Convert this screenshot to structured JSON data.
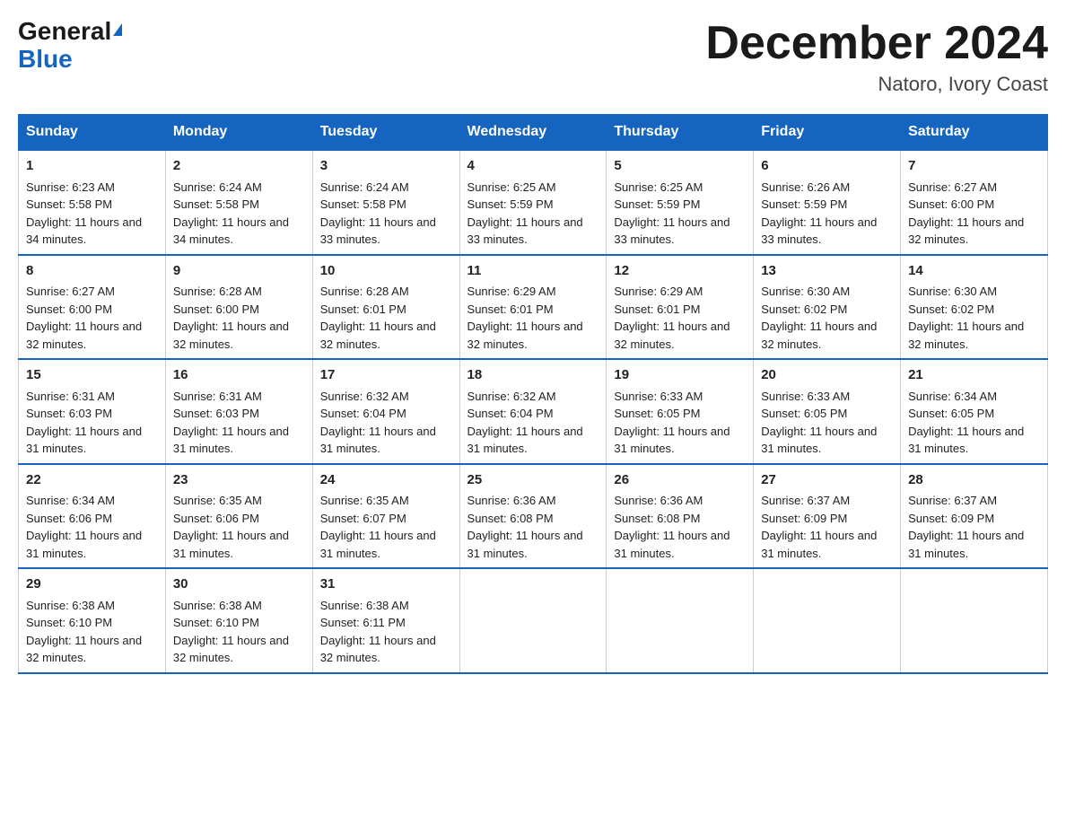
{
  "header": {
    "logo_general": "General",
    "logo_blue": "Blue",
    "month_title": "December 2024",
    "location": "Natoro, Ivory Coast"
  },
  "days_of_week": [
    "Sunday",
    "Monday",
    "Tuesday",
    "Wednesday",
    "Thursday",
    "Friday",
    "Saturday"
  ],
  "weeks": [
    [
      {
        "day": "1",
        "sunrise": "Sunrise: 6:23 AM",
        "sunset": "Sunset: 5:58 PM",
        "daylight": "Daylight: 11 hours and 34 minutes."
      },
      {
        "day": "2",
        "sunrise": "Sunrise: 6:24 AM",
        "sunset": "Sunset: 5:58 PM",
        "daylight": "Daylight: 11 hours and 34 minutes."
      },
      {
        "day": "3",
        "sunrise": "Sunrise: 6:24 AM",
        "sunset": "Sunset: 5:58 PM",
        "daylight": "Daylight: 11 hours and 33 minutes."
      },
      {
        "day": "4",
        "sunrise": "Sunrise: 6:25 AM",
        "sunset": "Sunset: 5:59 PM",
        "daylight": "Daylight: 11 hours and 33 minutes."
      },
      {
        "day": "5",
        "sunrise": "Sunrise: 6:25 AM",
        "sunset": "Sunset: 5:59 PM",
        "daylight": "Daylight: 11 hours and 33 minutes."
      },
      {
        "day": "6",
        "sunrise": "Sunrise: 6:26 AM",
        "sunset": "Sunset: 5:59 PM",
        "daylight": "Daylight: 11 hours and 33 minutes."
      },
      {
        "day": "7",
        "sunrise": "Sunrise: 6:27 AM",
        "sunset": "Sunset: 6:00 PM",
        "daylight": "Daylight: 11 hours and 32 minutes."
      }
    ],
    [
      {
        "day": "8",
        "sunrise": "Sunrise: 6:27 AM",
        "sunset": "Sunset: 6:00 PM",
        "daylight": "Daylight: 11 hours and 32 minutes."
      },
      {
        "day": "9",
        "sunrise": "Sunrise: 6:28 AM",
        "sunset": "Sunset: 6:00 PM",
        "daylight": "Daylight: 11 hours and 32 minutes."
      },
      {
        "day": "10",
        "sunrise": "Sunrise: 6:28 AM",
        "sunset": "Sunset: 6:01 PM",
        "daylight": "Daylight: 11 hours and 32 minutes."
      },
      {
        "day": "11",
        "sunrise": "Sunrise: 6:29 AM",
        "sunset": "Sunset: 6:01 PM",
        "daylight": "Daylight: 11 hours and 32 minutes."
      },
      {
        "day": "12",
        "sunrise": "Sunrise: 6:29 AM",
        "sunset": "Sunset: 6:01 PM",
        "daylight": "Daylight: 11 hours and 32 minutes."
      },
      {
        "day": "13",
        "sunrise": "Sunrise: 6:30 AM",
        "sunset": "Sunset: 6:02 PM",
        "daylight": "Daylight: 11 hours and 32 minutes."
      },
      {
        "day": "14",
        "sunrise": "Sunrise: 6:30 AM",
        "sunset": "Sunset: 6:02 PM",
        "daylight": "Daylight: 11 hours and 32 minutes."
      }
    ],
    [
      {
        "day": "15",
        "sunrise": "Sunrise: 6:31 AM",
        "sunset": "Sunset: 6:03 PM",
        "daylight": "Daylight: 11 hours and 31 minutes."
      },
      {
        "day": "16",
        "sunrise": "Sunrise: 6:31 AM",
        "sunset": "Sunset: 6:03 PM",
        "daylight": "Daylight: 11 hours and 31 minutes."
      },
      {
        "day": "17",
        "sunrise": "Sunrise: 6:32 AM",
        "sunset": "Sunset: 6:04 PM",
        "daylight": "Daylight: 11 hours and 31 minutes."
      },
      {
        "day": "18",
        "sunrise": "Sunrise: 6:32 AM",
        "sunset": "Sunset: 6:04 PM",
        "daylight": "Daylight: 11 hours and 31 minutes."
      },
      {
        "day": "19",
        "sunrise": "Sunrise: 6:33 AM",
        "sunset": "Sunset: 6:05 PM",
        "daylight": "Daylight: 11 hours and 31 minutes."
      },
      {
        "day": "20",
        "sunrise": "Sunrise: 6:33 AM",
        "sunset": "Sunset: 6:05 PM",
        "daylight": "Daylight: 11 hours and 31 minutes."
      },
      {
        "day": "21",
        "sunrise": "Sunrise: 6:34 AM",
        "sunset": "Sunset: 6:05 PM",
        "daylight": "Daylight: 11 hours and 31 minutes."
      }
    ],
    [
      {
        "day": "22",
        "sunrise": "Sunrise: 6:34 AM",
        "sunset": "Sunset: 6:06 PM",
        "daylight": "Daylight: 11 hours and 31 minutes."
      },
      {
        "day": "23",
        "sunrise": "Sunrise: 6:35 AM",
        "sunset": "Sunset: 6:06 PM",
        "daylight": "Daylight: 11 hours and 31 minutes."
      },
      {
        "day": "24",
        "sunrise": "Sunrise: 6:35 AM",
        "sunset": "Sunset: 6:07 PM",
        "daylight": "Daylight: 11 hours and 31 minutes."
      },
      {
        "day": "25",
        "sunrise": "Sunrise: 6:36 AM",
        "sunset": "Sunset: 6:08 PM",
        "daylight": "Daylight: 11 hours and 31 minutes."
      },
      {
        "day": "26",
        "sunrise": "Sunrise: 6:36 AM",
        "sunset": "Sunset: 6:08 PM",
        "daylight": "Daylight: 11 hours and 31 minutes."
      },
      {
        "day": "27",
        "sunrise": "Sunrise: 6:37 AM",
        "sunset": "Sunset: 6:09 PM",
        "daylight": "Daylight: 11 hours and 31 minutes."
      },
      {
        "day": "28",
        "sunrise": "Sunrise: 6:37 AM",
        "sunset": "Sunset: 6:09 PM",
        "daylight": "Daylight: 11 hours and 31 minutes."
      }
    ],
    [
      {
        "day": "29",
        "sunrise": "Sunrise: 6:38 AM",
        "sunset": "Sunset: 6:10 PM",
        "daylight": "Daylight: 11 hours and 32 minutes."
      },
      {
        "day": "30",
        "sunrise": "Sunrise: 6:38 AM",
        "sunset": "Sunset: 6:10 PM",
        "daylight": "Daylight: 11 hours and 32 minutes."
      },
      {
        "day": "31",
        "sunrise": "Sunrise: 6:38 AM",
        "sunset": "Sunset: 6:11 PM",
        "daylight": "Daylight: 11 hours and 32 minutes."
      },
      null,
      null,
      null,
      null
    ]
  ]
}
